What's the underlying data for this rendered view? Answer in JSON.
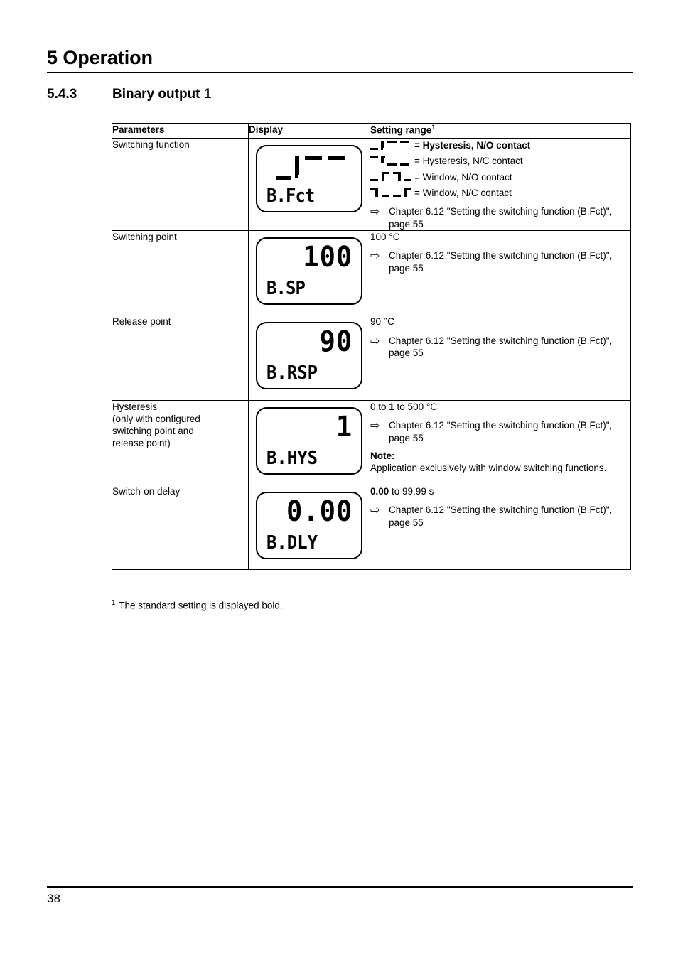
{
  "header": {
    "chapter_title": "5 Operation",
    "section_number": "5.4.3",
    "section_title": "Binary output 1"
  },
  "table": {
    "columns": [
      "Parameters",
      "Display",
      "Setting range"
    ],
    "setting_range_footnote_marker": "1",
    "rows": [
      {
        "parameter_lines": [
          "Switching function"
        ],
        "display": {
          "main": "wave",
          "main_wave": "low-high",
          "sub": "B.Fct"
        },
        "range": {
          "options": [
            {
              "glyph": "low-high",
              "label": "= Hysteresis, N/O contact",
              "bold": true
            },
            {
              "glyph": "high-low",
              "label": "= Hysteresis, N/C contact",
              "bold": false
            },
            {
              "glyph": "low-high-low",
              "label": "= Window, N/O contact",
              "bold": false
            },
            {
              "glyph": "high-low-high",
              "label": "= Window, N/C contact",
              "bold": false
            }
          ],
          "reference": "Chapter 6.12 \"Setting the switching function (B.Fct)\", page 55",
          "arrow": "⇨"
        }
      },
      {
        "parameter_lines": [
          "Switching point"
        ],
        "display": {
          "main": "100",
          "sub": "B.SP"
        },
        "range": {
          "value": "100 °C",
          "reference": "Chapter 6.12 \"Setting the switching function (B.Fct)\", page 55",
          "arrow": "⇨"
        }
      },
      {
        "parameter_lines": [
          "Release point"
        ],
        "display": {
          "main": "90",
          "sub": "B.RSP"
        },
        "range": {
          "value": "90 °C",
          "reference": "Chapter 6.12 \"Setting the switching function (B.Fct)\", page 55",
          "arrow": "⇨"
        }
      },
      {
        "parameter_lines": [
          "Hysteresis",
          "(only with configured",
          "switching point and",
          "release point)"
        ],
        "display": {
          "main": "1",
          "sub": "B.HYS"
        },
        "range": {
          "value_prefix": "0 to ",
          "value_bold": "1",
          "value_suffix": " to 500 °C",
          "reference": "Chapter 6.12 \"Setting the switching function (B.Fct)\", page 55",
          "arrow": "⇨",
          "note_label": "Note:",
          "note_text": "Application exclusively with window switching functions."
        }
      },
      {
        "parameter_lines": [
          "Switch-on delay"
        ],
        "display": {
          "main": "0.00",
          "sub": "B.DLY"
        },
        "range": {
          "value_bold": "0.00",
          "value_suffix": " to 99.99 s",
          "reference": "Chapter 6.12 \"Setting the switching function (B.Fct)\", page 55",
          "arrow": "⇨"
        }
      }
    ]
  },
  "footnote": {
    "marker": "1",
    "text": "The standard setting is displayed bold."
  },
  "footer": {
    "page_number": "38"
  }
}
